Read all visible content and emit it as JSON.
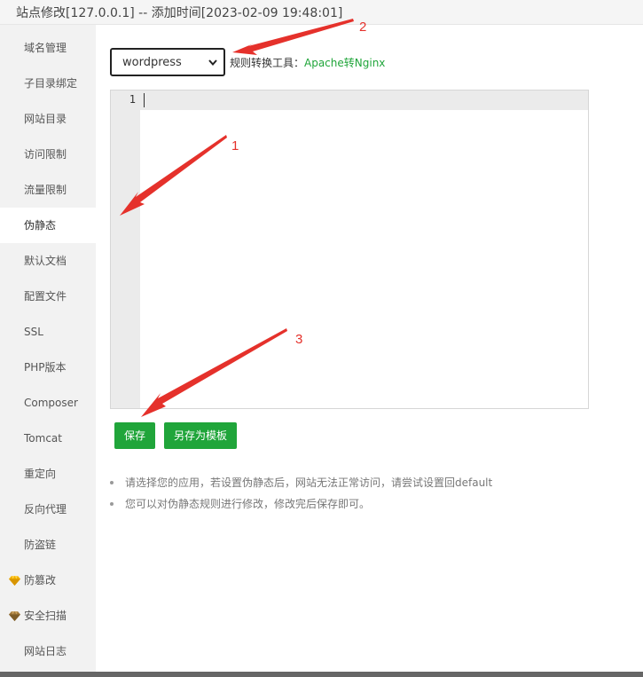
{
  "window": {
    "title": "站点修改[127.0.0.1] -- 添加时间[2023-02-09 19:48:01]"
  },
  "sidebar": {
    "items": [
      {
        "label": "域名管理"
      },
      {
        "label": "子目录绑定"
      },
      {
        "label": "网站目录"
      },
      {
        "label": "访问限制"
      },
      {
        "label": "流量限制"
      },
      {
        "label": "伪静态",
        "active": true
      },
      {
        "label": "默认文档"
      },
      {
        "label": "配置文件"
      },
      {
        "label": "SSL"
      },
      {
        "label": "PHP版本"
      },
      {
        "label": "Composer"
      },
      {
        "label": "Tomcat"
      },
      {
        "label": "重定向"
      },
      {
        "label": "反向代理"
      },
      {
        "label": "防盗链"
      },
      {
        "label": "防篡改",
        "icon": "gem-icon-gold"
      },
      {
        "label": "安全扫描",
        "icon": "gem-icon-bronze"
      },
      {
        "label": "网站日志"
      }
    ]
  },
  "rewrite": {
    "selected": "wordpress",
    "tool_label": "规则转换工具：",
    "tool_link": "Apache转Nginx"
  },
  "editor": {
    "line_number": "1",
    "content": ""
  },
  "buttons": {
    "save": "保存",
    "save_as_template": "另存为模板"
  },
  "tips": [
    "请选择您的应用，若设置伪静态后，网站无法正常访问，请尝试设置回default",
    "您可以对伪静态规则进行修改，修改完后保存即可。"
  ],
  "annotations": {
    "n1": "1",
    "n2": "2",
    "n3": "3"
  },
  "colors": {
    "accent": "#20a53a",
    "annotation": "#e5312b",
    "gem_gold": "#f0b000",
    "gem_bronze": "#a0793b"
  }
}
